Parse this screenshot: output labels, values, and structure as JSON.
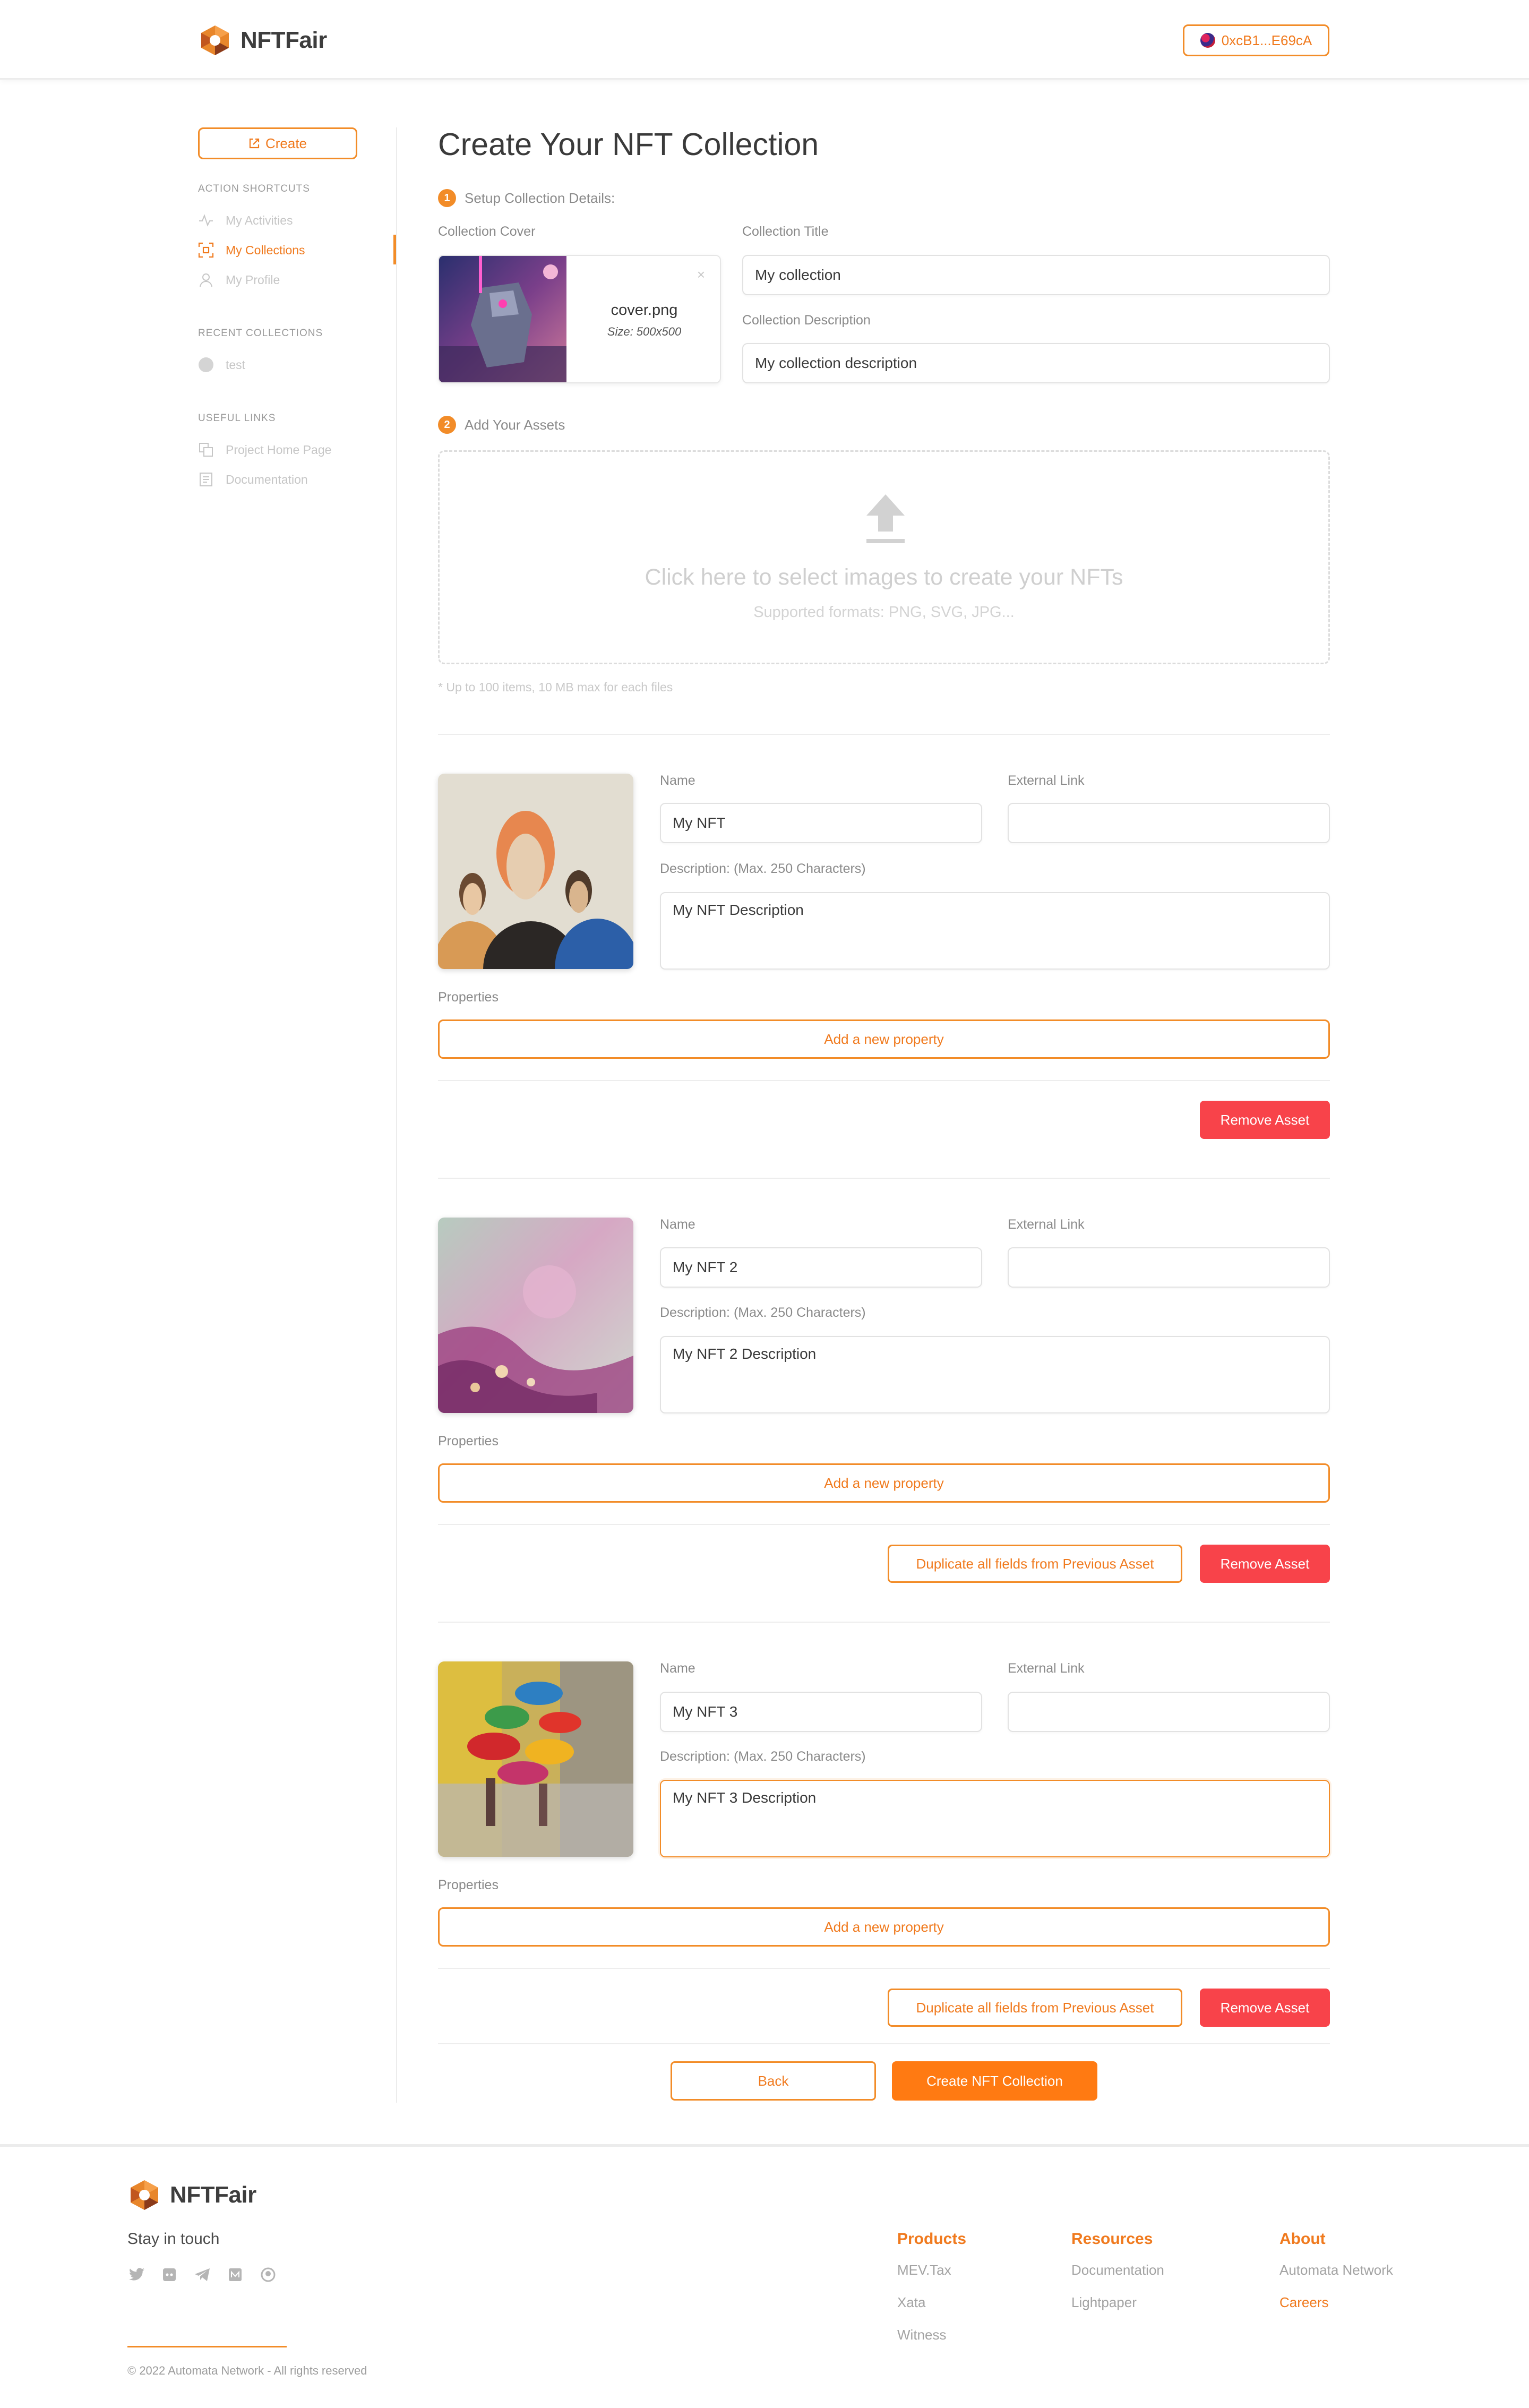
{
  "header": {
    "brand": "NFTFair",
    "wallet": "0xcB1...E69cA"
  },
  "sidebar": {
    "create_label": "Create",
    "shortcuts_heading": "ACTION SHORTCUTS",
    "shortcuts": [
      {
        "label": "My Activities",
        "icon": "activity-icon"
      },
      {
        "label": "My Collections",
        "icon": "collections-icon"
      },
      {
        "label": "My Profile",
        "icon": "user-icon"
      }
    ],
    "recent_heading": "RECENT COLLECTIONS",
    "recent": [
      {
        "label": "test"
      }
    ],
    "links_heading": "USEFUL LINKS",
    "links": [
      {
        "label": "Project Home Page",
        "icon": "home-page-icon"
      },
      {
        "label": "Documentation",
        "icon": "documentation-icon"
      }
    ]
  },
  "main": {
    "title": "Create Your NFT Collection",
    "step1": {
      "num": "1",
      "label": "Setup Collection Details:"
    },
    "cover": {
      "label": "Collection Cover",
      "file": "cover.png",
      "size": "Size: 500x500",
      "close": "×"
    },
    "collection_title": {
      "label": "Collection Title",
      "value": "My collection"
    },
    "collection_desc": {
      "label": "Collection Description",
      "value": "My collection description"
    },
    "step2": {
      "num": "2",
      "label": "Add Your Assets"
    },
    "dropzone": {
      "title": "Click here to select images to create your NFTs",
      "sub": "Supported formats: PNG, SVG, JPG..."
    },
    "hint": "* Up to 100 items, 10 MB max for each files",
    "labels": {
      "name": "Name",
      "external": "External Link",
      "description": "Description: (Max. 250 Characters)",
      "properties": "Properties",
      "add_property": "Add a new property",
      "remove": "Remove Asset",
      "duplicate": "Duplicate all fields from Previous Asset"
    },
    "assets": [
      {
        "name": "My NFT",
        "external": "",
        "description": "My NFT Description"
      },
      {
        "name": "My NFT 2",
        "external": "",
        "description": "My NFT 2 Description"
      },
      {
        "name": "My NFT 3",
        "external": "",
        "description": "My NFT 3 Description"
      }
    ],
    "back_label": "Back",
    "submit_label": "Create NFT Collection"
  },
  "footer": {
    "brand": "NFTFair",
    "stay": "Stay in touch",
    "socials": [
      "twitter-icon",
      "discord-icon",
      "telegram-icon",
      "medium-icon",
      "github-icon"
    ],
    "copyright": "© 2022 Automata Network - All rights reserved",
    "columns": [
      {
        "heading": "Products",
        "items": [
          "MEV.Tax",
          "Xata",
          "Witness"
        ]
      },
      {
        "heading": "Resources",
        "items": [
          "Documentation",
          "Lightpaper"
        ]
      },
      {
        "heading": "About",
        "items": [
          "Automata Network",
          "Careers"
        ]
      }
    ]
  },
  "colors": {
    "accent": "#f28c28",
    "danger": "#f8434a",
    "primary": "#ff7a12"
  }
}
